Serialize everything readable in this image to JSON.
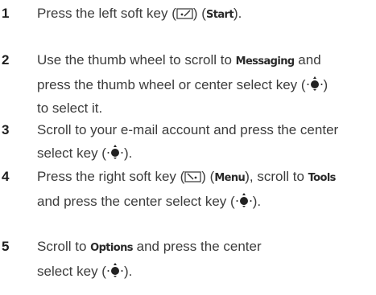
{
  "steps": [
    {
      "number": "1",
      "parts": {
        "a": "Press the left soft key (",
        "b": ") (",
        "kw1": "Start",
        "c": ")."
      },
      "icons": [
        "left-soft-key-icon"
      ]
    },
    {
      "number": "2",
      "parts": {
        "a": "Use the thumb wheel to scroll to ",
        "kw1": "Messaging",
        "b": " and",
        "c": "press the thumb wheel or center select key (",
        "d": ")",
        "e": "to select it."
      },
      "icons": [
        "center-select-key-icon"
      ]
    },
    {
      "number": "3",
      "parts": {
        "a": "Scroll to your e-mail account and press the center",
        "b": "select key (",
        "c": ")."
      },
      "icons": [
        "center-select-key-icon"
      ]
    },
    {
      "number": "4",
      "parts": {
        "a": "Press the right soft key (",
        "b": ") (",
        "kw1": "Menu",
        "c": "), scroll to ",
        "kw2": "Tools",
        "d": "and press the center select key (",
        "e": ")."
      },
      "icons": [
        "right-soft-key-icon",
        "center-select-key-icon"
      ]
    },
    {
      "number": "5",
      "parts": {
        "a": "Scroll to ",
        "kw1": "Options",
        "b": " and press the center",
        "c": "select key (",
        "d": ")."
      },
      "icons": [
        "center-select-key-icon"
      ]
    }
  ],
  "colors": {
    "text": "#3c3c3c",
    "number": "#1e1e1e"
  }
}
